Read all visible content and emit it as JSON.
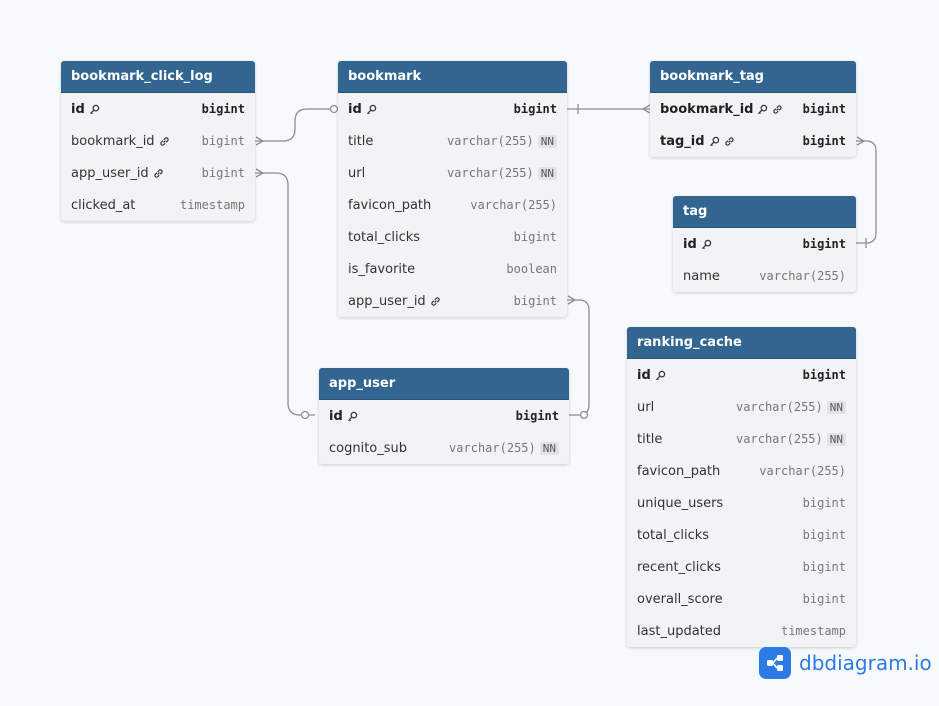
{
  "tables": [
    {
      "name": "bookmark_click_log",
      "columns": [
        {
          "name": "id",
          "type": "bigint",
          "pk": true,
          "fk": false,
          "nn": false
        },
        {
          "name": "bookmark_id",
          "type": "bigint",
          "pk": false,
          "fk": true,
          "nn": false
        },
        {
          "name": "app_user_id",
          "type": "bigint",
          "pk": false,
          "fk": true,
          "nn": false
        },
        {
          "name": "clicked_at",
          "type": "timestamp",
          "pk": false,
          "fk": false,
          "nn": false
        }
      ]
    },
    {
      "name": "bookmark",
      "columns": [
        {
          "name": "id",
          "type": "bigint",
          "pk": true,
          "fk": false,
          "nn": false
        },
        {
          "name": "title",
          "type": "varchar(255)",
          "pk": false,
          "fk": false,
          "nn": true
        },
        {
          "name": "url",
          "type": "varchar(255)",
          "pk": false,
          "fk": false,
          "nn": true
        },
        {
          "name": "favicon_path",
          "type": "varchar(255)",
          "pk": false,
          "fk": false,
          "nn": false
        },
        {
          "name": "total_clicks",
          "type": "bigint",
          "pk": false,
          "fk": false,
          "nn": false
        },
        {
          "name": "is_favorite",
          "type": "boolean",
          "pk": false,
          "fk": false,
          "nn": false
        },
        {
          "name": "app_user_id",
          "type": "bigint",
          "pk": false,
          "fk": true,
          "nn": false
        }
      ]
    },
    {
      "name": "bookmark_tag",
      "columns": [
        {
          "name": "bookmark_id",
          "type": "bigint",
          "pk": true,
          "fk": true,
          "nn": false
        },
        {
          "name": "tag_id",
          "type": "bigint",
          "pk": true,
          "fk": true,
          "nn": false
        }
      ]
    },
    {
      "name": "tag",
      "columns": [
        {
          "name": "id",
          "type": "bigint",
          "pk": true,
          "fk": false,
          "nn": false
        },
        {
          "name": "name",
          "type": "varchar(255)",
          "pk": false,
          "fk": false,
          "nn": false
        }
      ]
    },
    {
      "name": "app_user",
      "columns": [
        {
          "name": "id",
          "type": "bigint",
          "pk": true,
          "fk": false,
          "nn": false
        },
        {
          "name": "cognito_sub",
          "type": "varchar(255)",
          "pk": false,
          "fk": false,
          "nn": true
        }
      ]
    },
    {
      "name": "ranking_cache",
      "columns": [
        {
          "name": "id",
          "type": "bigint",
          "pk": true,
          "fk": false,
          "nn": false
        },
        {
          "name": "url",
          "type": "varchar(255)",
          "pk": false,
          "fk": false,
          "nn": true
        },
        {
          "name": "title",
          "type": "varchar(255)",
          "pk": false,
          "fk": false,
          "nn": true
        },
        {
          "name": "favicon_path",
          "type": "varchar(255)",
          "pk": false,
          "fk": false,
          "nn": false
        },
        {
          "name": "unique_users",
          "type": "bigint",
          "pk": false,
          "fk": false,
          "nn": false
        },
        {
          "name": "total_clicks",
          "type": "bigint",
          "pk": false,
          "fk": false,
          "nn": false
        },
        {
          "name": "recent_clicks",
          "type": "bigint",
          "pk": false,
          "fk": false,
          "nn": false
        },
        {
          "name": "overall_score",
          "type": "bigint",
          "pk": false,
          "fk": false,
          "nn": false
        },
        {
          "name": "last_updated",
          "type": "timestamp",
          "pk": false,
          "fk": false,
          "nn": false
        }
      ]
    }
  ],
  "nn_label": "NN",
  "brand": {
    "name": "dbdiagram.io",
    "icon": "share-nodes-icon",
    "color": "#2c7be5"
  },
  "colors": {
    "header": "#336591",
    "body": "#f2f3f5",
    "link": "#8a8f96"
  }
}
